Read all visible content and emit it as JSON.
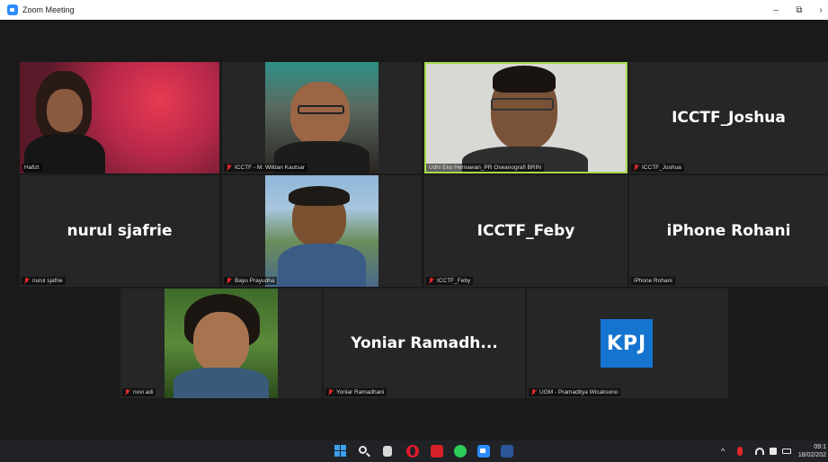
{
  "window": {
    "title": "Zoom Meeting",
    "minimize_glyph": "–",
    "restore_glyph": "⧉",
    "close_glyph": "›"
  },
  "participants": [
    {
      "display": "Hafizt",
      "label": "Hafizt",
      "video": true,
      "muted": false
    },
    {
      "display": "ICCTF - M. Wildan Kautsar",
      "label": "ICCTF - M. Wildan Kautsar",
      "video": true,
      "muted": true
    },
    {
      "display": "Udhi Eko Hernawan_PR Oseanografi BRIN",
      "label": "Udhi Eko Hernawan_PR Oseanografi BRIN",
      "video": true,
      "muted": false,
      "active_speaker": true
    },
    {
      "display": "ICCTF_Joshua",
      "label": "ICCTF_Joshua",
      "video": false,
      "muted": true
    },
    {
      "display": "nurul sjafrie",
      "label": "nurul sjafrie",
      "video": false,
      "muted": true
    },
    {
      "display": "Bayu Prayudha",
      "label": "Bayu Prayudha",
      "video": true,
      "muted": true
    },
    {
      "display": "ICCTF_Feby",
      "label": "ICCTF_Feby",
      "video": false,
      "muted": true
    },
    {
      "display": "iPhone Rohani",
      "label": "iPhone Rohani",
      "video": false,
      "muted": false
    },
    {
      "display": "novi adi",
      "label": "novi adi",
      "video": true,
      "muted": true
    },
    {
      "display": "Yoniar  Ramadh...",
      "label": "Yoniar Ramadhani",
      "video": false,
      "muted": true
    },
    {
      "display": "KPJ",
      "label": "UGM - Pramaditya Wicaksono",
      "video": false,
      "muted": true,
      "avatar_text": "KPJ"
    }
  ],
  "taskbar": {
    "apps": [
      "windows-start",
      "search",
      "file-explorer",
      "opera",
      "acrobat",
      "whatsapp",
      "zoom",
      "word"
    ],
    "tray_chevron": "^",
    "clock_time": "09:1",
    "clock_date": "18/02/202"
  },
  "colors": {
    "active_speaker_border": "#a6d94a",
    "muted_icon": "#e02828",
    "kpj_background": "#1674d1"
  }
}
